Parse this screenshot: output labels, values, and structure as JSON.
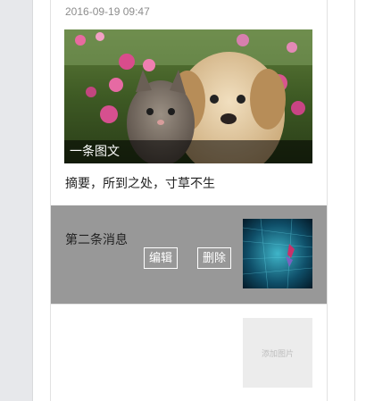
{
  "feed": {
    "timestamp": "2016-09-19 09:47",
    "cover_caption": "一条图文",
    "summary": "摘要，所到之处，寸草不生"
  },
  "second_item": {
    "title": "第二条消息",
    "edit_label": "编辑",
    "delete_label": "删除"
  },
  "add_image": {
    "label": "添加图片"
  },
  "colors": {
    "gutter": "#e7e8eb",
    "selected_item_bg": "#989898",
    "caption_bar": "#000000",
    "placeholder_bg": "#ececec"
  }
}
